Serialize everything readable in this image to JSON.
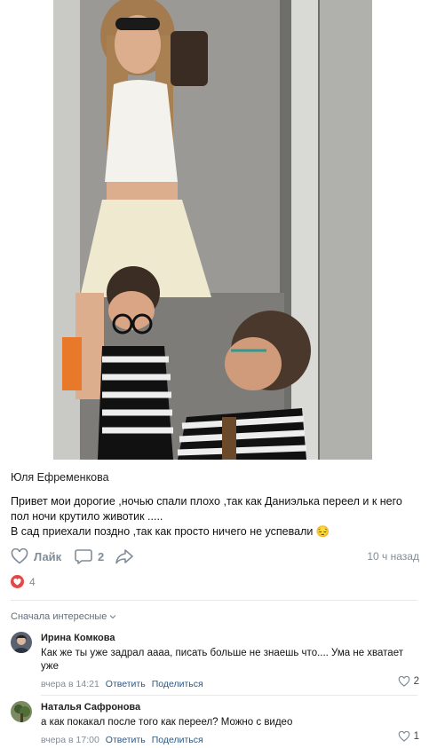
{
  "post": {
    "author": "Юля Ефременкова",
    "text_lines": [
      "Привет мои дорогие ,ночью спали плохо ,так как Даниэлька переел и к него",
      "пол ночи крутило животик .....",
      "В сад приехали поздно ,так как просто ничего не успевали 😔"
    ],
    "like_label": "Лайк",
    "comments_count": "2",
    "time": "10 ч назад",
    "reactions_count": "4"
  },
  "comments_section": {
    "sort_label": "Сначала интересные"
  },
  "comments": [
    {
      "author": "Ирина Комкова",
      "text": "Как же ты уже задрал аааа, писать больше не знаешь что.... Ума не хватает уже",
      "time": "вчера в 14:21",
      "reply_label": "Ответить",
      "share_label": "Поделиться",
      "likes": "2"
    },
    {
      "author": "Наталья Сафронова",
      "text": "а как покакал после того как переел? Можно с видео",
      "time": "вчера в 17:00",
      "reply_label": "Ответить",
      "share_label": "Поделиться",
      "likes": "1"
    }
  ],
  "colors": {
    "secondary_text": "#818c99",
    "link": "#2a5885",
    "heart": "#e64646",
    "divider": "#e7e8ec"
  },
  "icons": {
    "like": "heart-outline-icon",
    "comment": "speech-bubble-icon",
    "share": "share-arrow-icon",
    "reaction": "heart-filled-icon",
    "sort": "chevron-down-icon"
  }
}
